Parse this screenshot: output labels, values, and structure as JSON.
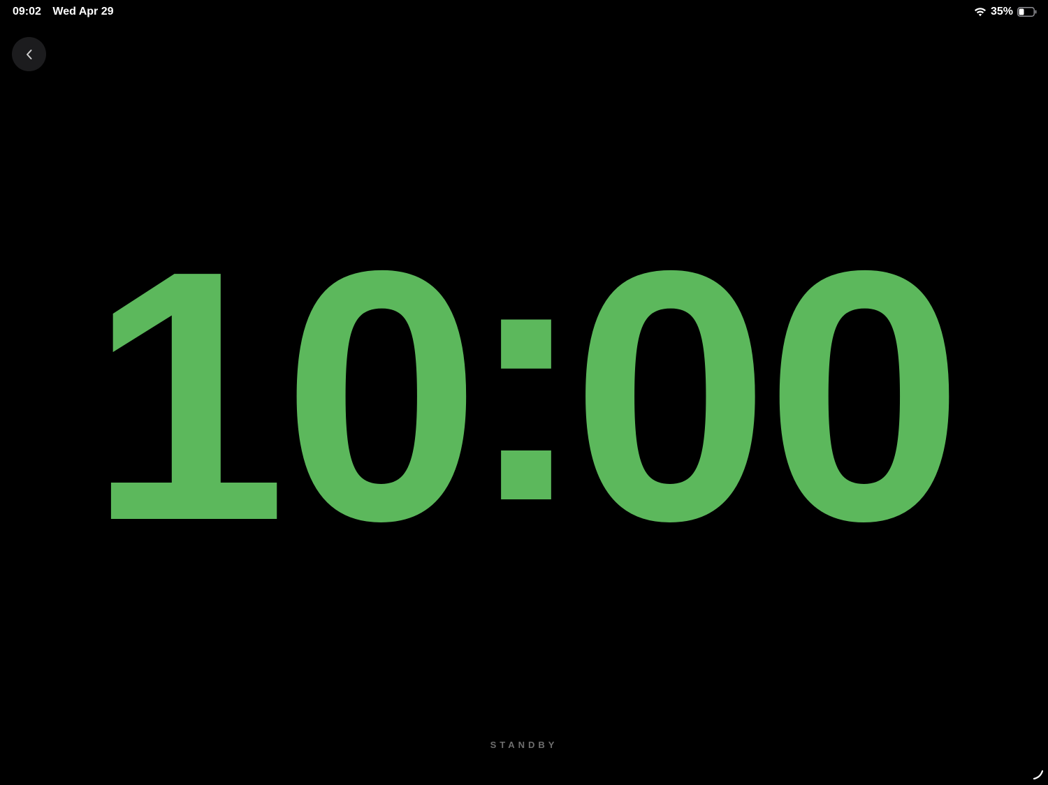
{
  "status_bar": {
    "time": "09:02",
    "date": "Wed Apr 29",
    "battery_percent": "35%",
    "battery_level": 0.35,
    "icons": [
      "wifi-icon",
      "battery-icon"
    ]
  },
  "back_button": {
    "icon": "chevron-left-icon"
  },
  "clock": {
    "hours": "10",
    "separator": ":",
    "minutes": "00",
    "color": "#5cb85c"
  },
  "footer": {
    "label": "STANDBY"
  },
  "colors": {
    "background": "#000000",
    "accent": "#5cb85c",
    "muted_text": "#6e6e6e"
  }
}
